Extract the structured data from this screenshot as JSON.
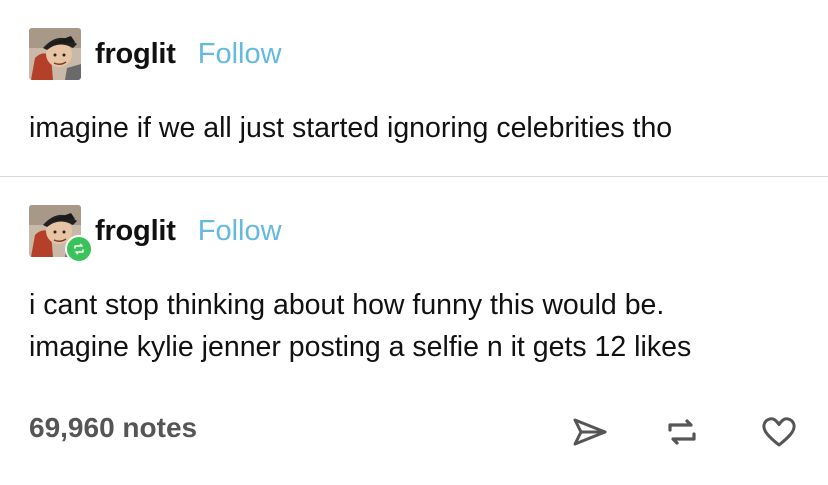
{
  "posts": [
    {
      "username": "froglit",
      "follow_label": "Follow",
      "text_lines": [
        "imagine if we all just started ignoring celebrities tho"
      ]
    },
    {
      "username": "froglit",
      "follow_label": "Follow",
      "reblogged": true,
      "text_lines": [
        "i cant stop thinking about how funny this would be.",
        "imagine kylie jenner posting a selfie n it gets 12 likes"
      ]
    }
  ],
  "footer": {
    "notes": "69,960 notes",
    "actions": [
      "share-icon",
      "reblog-icon",
      "heart-icon"
    ]
  },
  "colors": {
    "follow": "#64b9e0",
    "reblog_badge": "#3ac35a",
    "notes_text": "#555555",
    "divider": "#d9d9d9"
  }
}
